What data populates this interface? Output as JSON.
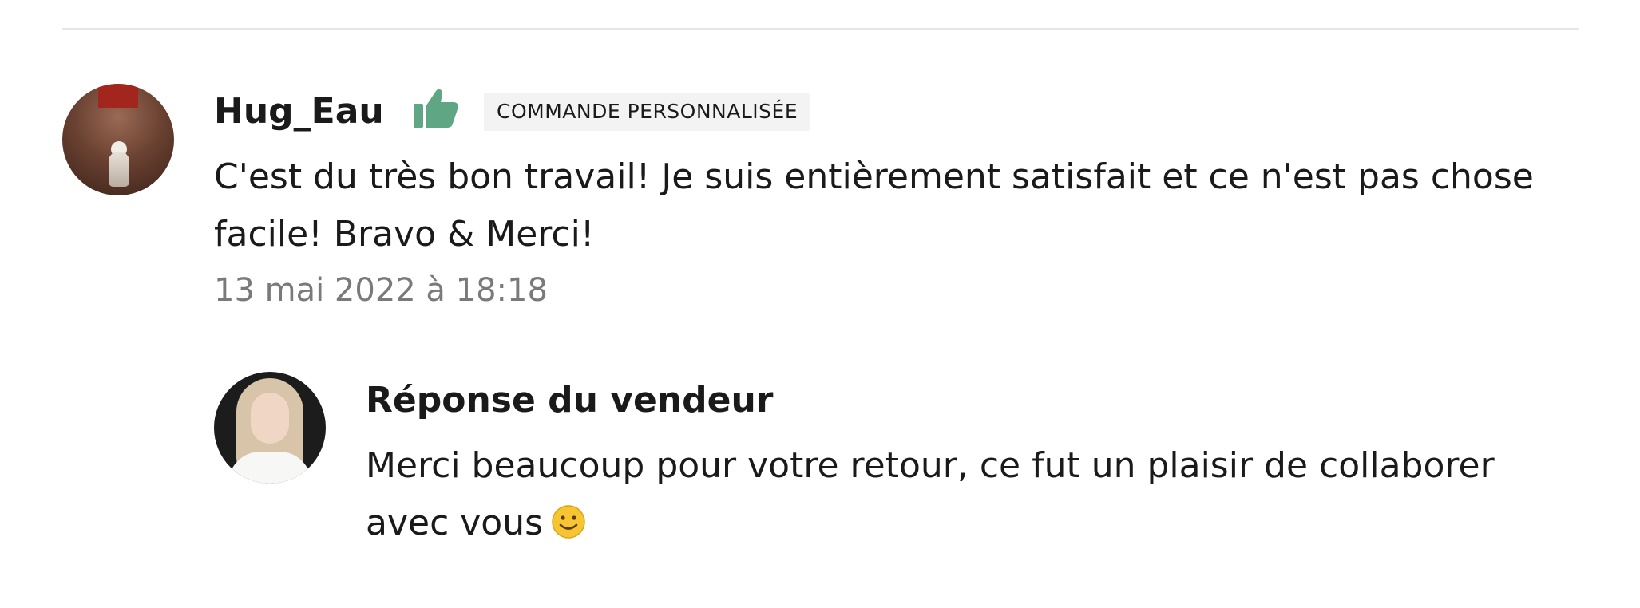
{
  "review": {
    "username": "Hug_Eau",
    "badge": "COMMANDE PERSONNALISÉE",
    "text": "C'est du très bon travail! Je suis entièrement satisfait et ce n'est pas chose facile! Bravo & Merci!",
    "date": "13 mai 2022 à 18:18",
    "rating_icon": "thumbs-up-icon",
    "accent_color": "#5fa784"
  },
  "seller_reply": {
    "title": "Réponse du vendeur",
    "text": "Merci beaucoup pour votre retour, ce fut un plaisir de collaborer avec vous",
    "emoji_icon": "smiley-icon"
  }
}
